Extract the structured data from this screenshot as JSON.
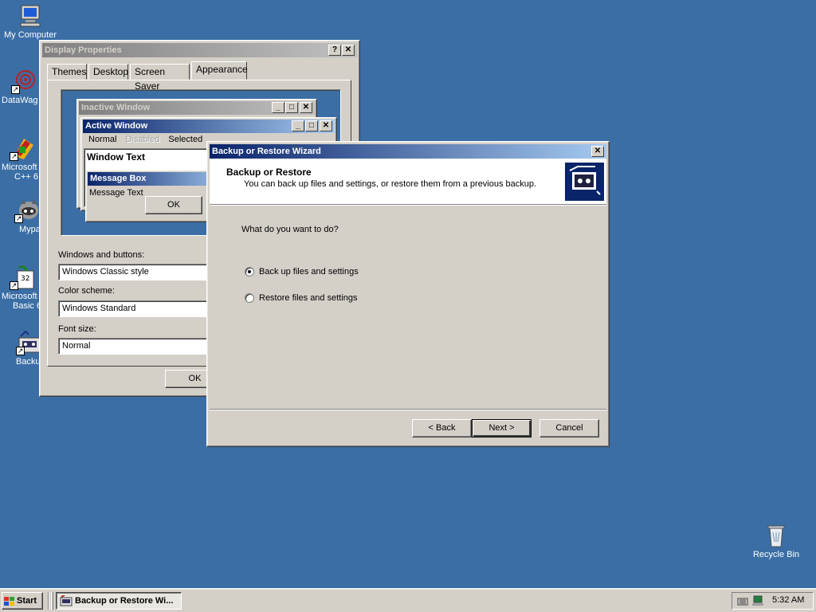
{
  "desktop": {
    "icons": [
      {
        "label": "My Computer"
      },
      {
        "label": "DataWag"
      },
      {
        "label": "Microsoft"
      },
      {
        "label": "C++ 6"
      },
      {
        "label": "Mypa"
      },
      {
        "label": "Microsoft"
      },
      {
        "label": "Basic 6"
      },
      {
        "label": "Backu"
      },
      {
        "label": "Recycle Bin"
      }
    ]
  },
  "display_properties": {
    "title": "Display Properties",
    "help_btn": "?",
    "close_btn": "✕",
    "tabs": [
      "Themes",
      "Desktop",
      "Screen Saver",
      "Appearance"
    ],
    "preview": {
      "inactive_title": "Inactive Window",
      "active_title": "Active Window",
      "menu": [
        "Normal",
        "Disabled",
        "Selected"
      ],
      "window_text": "Window Text",
      "message_box_title": "Message Box",
      "message_text": "Message Text",
      "ok": "OK"
    },
    "windows_buttons_label": "Windows and buttons:",
    "windows_buttons_value": "Windows Classic style",
    "color_scheme_label": "Color scheme:",
    "color_scheme_value": "Windows Standard",
    "font_size_label": "Font size:",
    "font_size_value": "Normal",
    "ok": "OK"
  },
  "wizard": {
    "title": "Backup or Restore Wizard",
    "close_btn": "✕",
    "header_title": "Backup or Restore",
    "header_subtitle": "You can back up files and settings, or restore them from a previous backup.",
    "question": "What do you want to do?",
    "options": [
      {
        "label": "Back up files and settings",
        "selected": true
      },
      {
        "label": "Restore files and settings",
        "selected": false
      }
    ],
    "back": "< Back",
    "next": "Next >",
    "cancel": "Cancel"
  },
  "taskbar": {
    "start": "Start",
    "task": "Backup or Restore Wi...",
    "clock": "5:32 AM"
  },
  "colors": {
    "desktop": "#3a6ea5",
    "face": "#d4d0c8",
    "active_title_start": "#0a246a",
    "active_title_end": "#a6caf0"
  }
}
